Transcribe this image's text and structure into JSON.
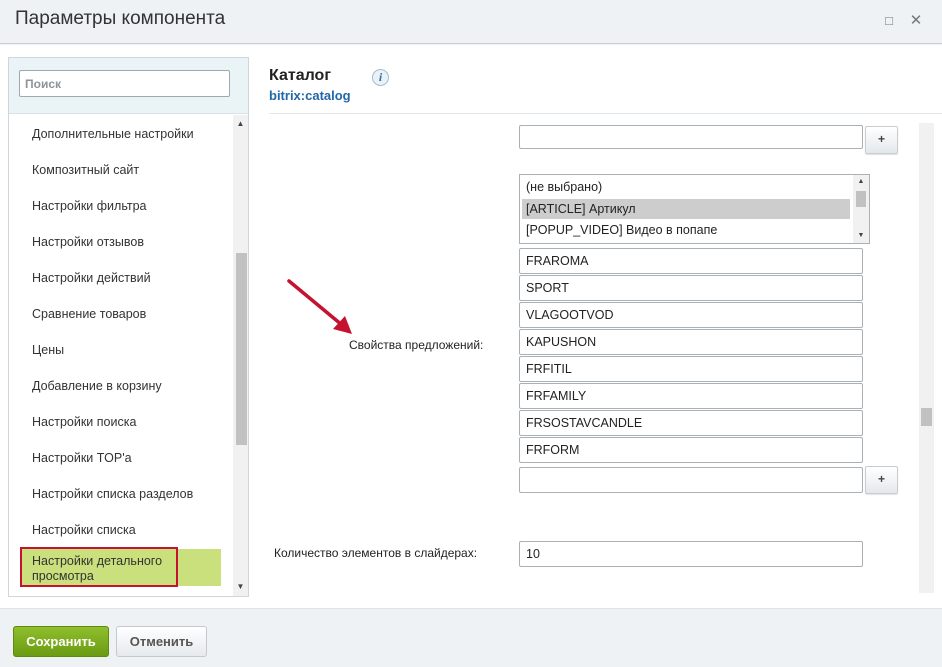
{
  "window": {
    "title": "Параметры компонента",
    "maximize_glyph": "□",
    "close_glyph": "✕"
  },
  "sidebar": {
    "search_placeholder": "Поиск",
    "items": [
      {
        "label": "Дополнительные настройки"
      },
      {
        "label": "Композитный сайт"
      },
      {
        "label": "Настройки фильтра"
      },
      {
        "label": "Настройки отзывов"
      },
      {
        "label": "Настройки действий"
      },
      {
        "label": "Сравнение товаров"
      },
      {
        "label": "Цены"
      },
      {
        "label": "Добавление в корзину"
      },
      {
        "label": "Настройки поиска"
      },
      {
        "label": "Настройки TOP'а"
      },
      {
        "label": "Настройки списка разделов"
      },
      {
        "label": "Настройки списка"
      },
      {
        "label": "Настройки детального просмотра"
      }
    ],
    "active_index": 12
  },
  "component": {
    "title": "Каталог",
    "code": "bitrix:catalog",
    "info_glyph": "i"
  },
  "offer_properties": {
    "label": "Свойства предложений:",
    "top_input_value": "",
    "select_options": [
      {
        "label": "(не выбрано)",
        "selected": false
      },
      {
        "label": "[ARTICLE] Артикул",
        "selected": true
      },
      {
        "label": "[POPUP_VIDEO] Видео в попапе",
        "selected": false
      }
    ],
    "values": [
      "FRAROMA",
      "SPORT",
      "VLAGOOTVOD",
      "KAPUSHON",
      "FRFITIL",
      "FRFAMILY",
      "FRSOSTAVCANDLE",
      "FRFORM"
    ],
    "empty_input_value": "",
    "add_label": "+"
  },
  "slider_count": {
    "label": "Количество элементов в слайдерах:",
    "value": "10"
  },
  "footer": {
    "save_label": "Сохранить",
    "cancel_label": "Отменить"
  },
  "colors": {
    "active_item": "#c9e07c",
    "highlight_outline": "#c4122f",
    "annotation_arrow": "#c4122f",
    "save_button": "#7aad1e",
    "component_code": "#2267a8"
  },
  "icons": {
    "scroll_up": "▲",
    "scroll_down": "▼"
  }
}
